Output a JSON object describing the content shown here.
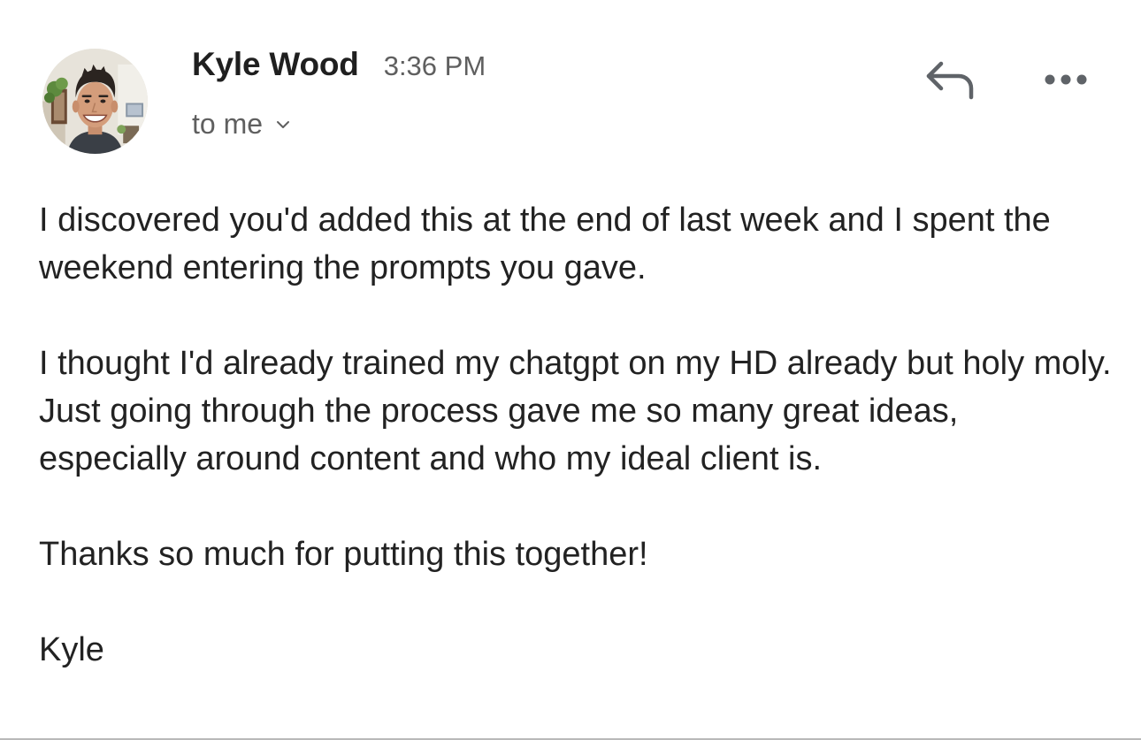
{
  "header": {
    "sender_name": "Kyle Wood",
    "time": "3:36 PM",
    "recipients_label": "to me"
  },
  "icons": {
    "reply": "reply-icon",
    "more": "more-options-icon",
    "expand": "chevron-down-icon",
    "avatar": "avatar"
  },
  "body": {
    "paragraph_1": "I discovered you'd added this at the end of last week and I spent the weekend entering the prompts you gave.",
    "paragraph_2": "I thought I'd already trained my chatgpt on my HD already but holy moly. Just going through the process gave me so many great ideas, especially around content and who my ideal client is.",
    "paragraph_3": "Thanks so much for putting this together!",
    "signature": "Kyle"
  },
  "colors": {
    "text_primary": "#222222",
    "text_secondary": "#5f5f5f",
    "icon": "#5f6368",
    "background": "#ffffff"
  }
}
